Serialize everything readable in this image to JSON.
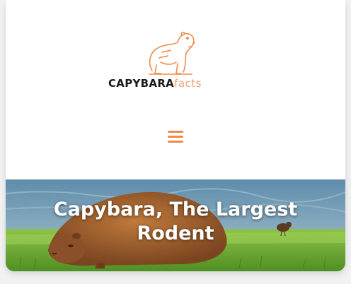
{
  "brand": {
    "name_main": "CAPYBARA",
    "name_sub": "facts",
    "accent_color": "#f08a4b",
    "logo_icon": "capybara-logo-icon"
  },
  "nav": {
    "menu_icon": "hamburger-menu-icon"
  },
  "hero": {
    "title_line1": "Capybara, The Largest",
    "title_line2": "Rodent",
    "image": "capybara-lying-on-grass-photo"
  }
}
